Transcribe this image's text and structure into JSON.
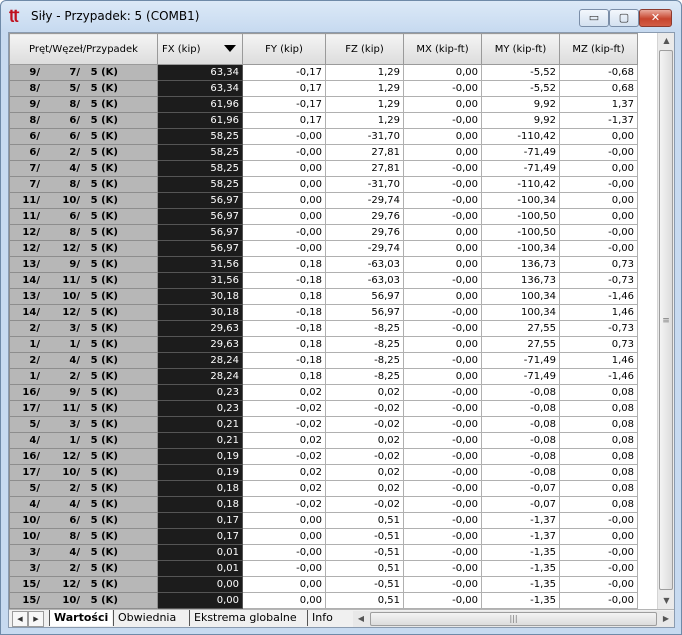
{
  "window": {
    "title": "Siły - Przypadek: 5 (COMB1)",
    "icon": "force-app-icon",
    "minimize_label": "▭",
    "maximize_label": "▢",
    "close_label": "✕"
  },
  "table": {
    "columns": [
      "Pręt/Węzeł/Przypadek",
      "FX (kip)",
      "FY (kip)",
      "FZ (kip)",
      "MX (kip-ft)",
      "MY (kip-ft)",
      "MZ (kip-ft)"
    ],
    "sorted_column": "FX (kip)",
    "sort_direction": "descending",
    "rows": [
      {
        "member": "9/",
        "node": "7/",
        "case": "5 (K)",
        "fx": "63,34",
        "fy": "-0,17",
        "fz": "1,29",
        "mx": "0,00",
        "my": "-5,52",
        "mz": "-0,68"
      },
      {
        "member": "8/",
        "node": "5/",
        "case": "5 (K)",
        "fx": "63,34",
        "fy": "0,17",
        "fz": "1,29",
        "mx": "-0,00",
        "my": "-5,52",
        "mz": "0,68"
      },
      {
        "member": "9/",
        "node": "8/",
        "case": "5 (K)",
        "fx": "61,96",
        "fy": "-0,17",
        "fz": "1,29",
        "mx": "0,00",
        "my": "9,92",
        "mz": "1,37"
      },
      {
        "member": "8/",
        "node": "6/",
        "case": "5 (K)",
        "fx": "61,96",
        "fy": "0,17",
        "fz": "1,29",
        "mx": "-0,00",
        "my": "9,92",
        "mz": "-1,37"
      },
      {
        "member": "6/",
        "node": "6/",
        "case": "5 (K)",
        "fx": "58,25",
        "fy": "-0,00",
        "fz": "-31,70",
        "mx": "0,00",
        "my": "-110,42",
        "mz": "0,00"
      },
      {
        "member": "6/",
        "node": "2/",
        "case": "5 (K)",
        "fx": "58,25",
        "fy": "-0,00",
        "fz": "27,81",
        "mx": "0,00",
        "my": "-71,49",
        "mz": "-0,00"
      },
      {
        "member": "7/",
        "node": "4/",
        "case": "5 (K)",
        "fx": "58,25",
        "fy": "0,00",
        "fz": "27,81",
        "mx": "-0,00",
        "my": "-71,49",
        "mz": "0,00"
      },
      {
        "member": "7/",
        "node": "8/",
        "case": "5 (K)",
        "fx": "58,25",
        "fy": "0,00",
        "fz": "-31,70",
        "mx": "-0,00",
        "my": "-110,42",
        "mz": "-0,00"
      },
      {
        "member": "11/",
        "node": "10/",
        "case": "5 (K)",
        "fx": "56,97",
        "fy": "0,00",
        "fz": "-29,74",
        "mx": "-0,00",
        "my": "-100,34",
        "mz": "0,00"
      },
      {
        "member": "11/",
        "node": "6/",
        "case": "5 (K)",
        "fx": "56,97",
        "fy": "0,00",
        "fz": "29,76",
        "mx": "-0,00",
        "my": "-100,50",
        "mz": "0,00"
      },
      {
        "member": "12/",
        "node": "8/",
        "case": "5 (K)",
        "fx": "56,97",
        "fy": "-0,00",
        "fz": "29,76",
        "mx": "0,00",
        "my": "-100,50",
        "mz": "-0,00"
      },
      {
        "member": "12/",
        "node": "12/",
        "case": "5 (K)",
        "fx": "56,97",
        "fy": "-0,00",
        "fz": "-29,74",
        "mx": "0,00",
        "my": "-100,34",
        "mz": "-0,00"
      },
      {
        "member": "13/",
        "node": "9/",
        "case": "5 (K)",
        "fx": "31,56",
        "fy": "0,18",
        "fz": "-63,03",
        "mx": "0,00",
        "my": "136,73",
        "mz": "0,73"
      },
      {
        "member": "14/",
        "node": "11/",
        "case": "5 (K)",
        "fx": "31,56",
        "fy": "-0,18",
        "fz": "-63,03",
        "mx": "-0,00",
        "my": "136,73",
        "mz": "-0,73"
      },
      {
        "member": "13/",
        "node": "10/",
        "case": "5 (K)",
        "fx": "30,18",
        "fy": "0,18",
        "fz": "56,97",
        "mx": "0,00",
        "my": "100,34",
        "mz": "-1,46"
      },
      {
        "member": "14/",
        "node": "12/",
        "case": "5 (K)",
        "fx": "30,18",
        "fy": "-0,18",
        "fz": "56,97",
        "mx": "-0,00",
        "my": "100,34",
        "mz": "1,46"
      },
      {
        "member": "2/",
        "node": "3/",
        "case": "5 (K)",
        "fx": "29,63",
        "fy": "-0,18",
        "fz": "-8,25",
        "mx": "-0,00",
        "my": "27,55",
        "mz": "-0,73"
      },
      {
        "member": "1/",
        "node": "1/",
        "case": "5 (K)",
        "fx": "29,63",
        "fy": "0,18",
        "fz": "-8,25",
        "mx": "0,00",
        "my": "27,55",
        "mz": "0,73"
      },
      {
        "member": "2/",
        "node": "4/",
        "case": "5 (K)",
        "fx": "28,24",
        "fy": "-0,18",
        "fz": "-8,25",
        "mx": "-0,00",
        "my": "-71,49",
        "mz": "1,46"
      },
      {
        "member": "1/",
        "node": "2/",
        "case": "5 (K)",
        "fx": "28,24",
        "fy": "0,18",
        "fz": "-8,25",
        "mx": "0,00",
        "my": "-71,49",
        "mz": "-1,46"
      },
      {
        "member": "16/",
        "node": "9/",
        "case": "5 (K)",
        "fx": "0,23",
        "fy": "0,02",
        "fz": "0,02",
        "mx": "-0,00",
        "my": "-0,08",
        "mz": "0,08"
      },
      {
        "member": "17/",
        "node": "11/",
        "case": "5 (K)",
        "fx": "0,23",
        "fy": "-0,02",
        "fz": "-0,02",
        "mx": "-0,00",
        "my": "-0,08",
        "mz": "0,08"
      },
      {
        "member": "5/",
        "node": "3/",
        "case": "5 (K)",
        "fx": "0,21",
        "fy": "-0,02",
        "fz": "-0,02",
        "mx": "-0,00",
        "my": "-0,08",
        "mz": "0,08"
      },
      {
        "member": "4/",
        "node": "1/",
        "case": "5 (K)",
        "fx": "0,21",
        "fy": "0,02",
        "fz": "0,02",
        "mx": "-0,00",
        "my": "-0,08",
        "mz": "0,08"
      },
      {
        "member": "16/",
        "node": "12/",
        "case": "5 (K)",
        "fx": "0,19",
        "fy": "-0,02",
        "fz": "-0,02",
        "mx": "-0,00",
        "my": "-0,08",
        "mz": "0,08"
      },
      {
        "member": "17/",
        "node": "10/",
        "case": "5 (K)",
        "fx": "0,19",
        "fy": "0,02",
        "fz": "0,02",
        "mx": "-0,00",
        "my": "-0,08",
        "mz": "0,08"
      },
      {
        "member": "5/",
        "node": "2/",
        "case": "5 (K)",
        "fx": "0,18",
        "fy": "0,02",
        "fz": "0,02",
        "mx": "-0,00",
        "my": "-0,07",
        "mz": "0,08"
      },
      {
        "member": "4/",
        "node": "4/",
        "case": "5 (K)",
        "fx": "0,18",
        "fy": "-0,02",
        "fz": "-0,02",
        "mx": "-0,00",
        "my": "-0,07",
        "mz": "0,08"
      },
      {
        "member": "10/",
        "node": "6/",
        "case": "5 (K)",
        "fx": "0,17",
        "fy": "0,00",
        "fz": "0,51",
        "mx": "-0,00",
        "my": "-1,37",
        "mz": "-0,00"
      },
      {
        "member": "10/",
        "node": "8/",
        "case": "5 (K)",
        "fx": "0,17",
        "fy": "0,00",
        "fz": "-0,51",
        "mx": "-0,00",
        "my": "-1,37",
        "mz": "0,00"
      },
      {
        "member": "3/",
        "node": "4/",
        "case": "5 (K)",
        "fx": "0,01",
        "fy": "-0,00",
        "fz": "-0,51",
        "mx": "-0,00",
        "my": "-1,35",
        "mz": "-0,00"
      },
      {
        "member": "3/",
        "node": "2/",
        "case": "5 (K)",
        "fx": "0,01",
        "fy": "-0,00",
        "fz": "0,51",
        "mx": "-0,00",
        "my": "-1,35",
        "mz": "-0,00"
      },
      {
        "member": "15/",
        "node": "12/",
        "case": "5 (K)",
        "fx": "0,00",
        "fy": "0,00",
        "fz": "-0,51",
        "mx": "-0,00",
        "my": "-1,35",
        "mz": "-0,00"
      },
      {
        "member": "15/",
        "node": "10/",
        "case": "5 (K)",
        "fx": "0,00",
        "fy": "0,00",
        "fz": "0,51",
        "mx": "-0,00",
        "my": "-1,35",
        "mz": "-0,00"
      }
    ]
  },
  "tabs": [
    {
      "label": "Wartości",
      "active": true
    },
    {
      "label": "Obwiednia",
      "active": false
    },
    {
      "label": "Ekstrema globalne",
      "active": false
    },
    {
      "label": "Info",
      "active": false
    }
  ]
}
